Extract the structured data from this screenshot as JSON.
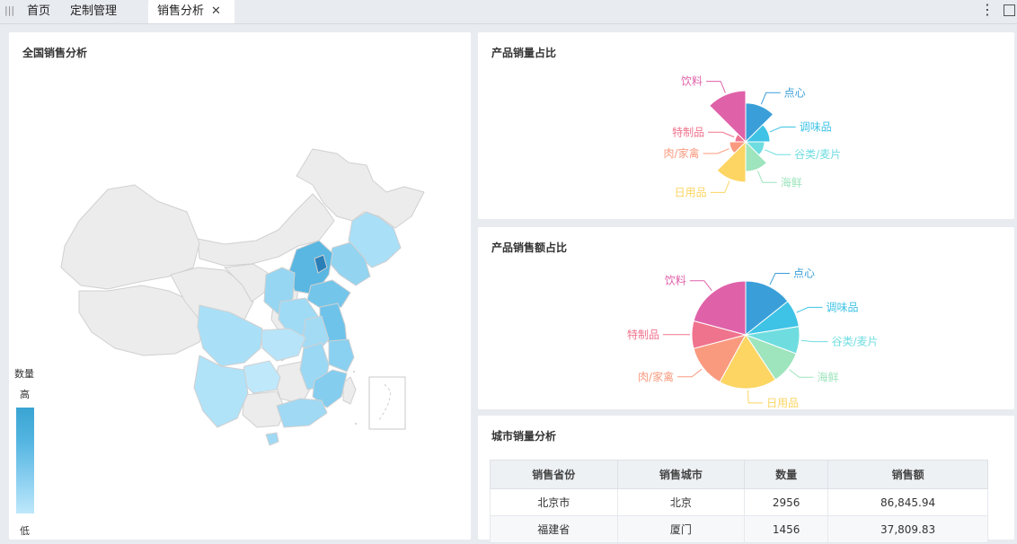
{
  "tabs": {
    "home": "首页",
    "custom": "定制管理",
    "sales": "销售分析",
    "close": "✕"
  },
  "map_panel": {
    "title": "全国销售分析",
    "legend_title": "数量",
    "legend_high": "高",
    "legend_low": "低",
    "colors": {
      "high": "#3aa4d3",
      "low": "#bee8fb",
      "nodata": "#ececec"
    }
  },
  "qty_panel": {
    "title": "产品销量占比"
  },
  "amt_panel": {
    "title": "产品销售额占比"
  },
  "city_panel": {
    "title": "城市销量分析",
    "columns": [
      "销售省份",
      "销售城市",
      "数量",
      "销售额"
    ],
    "rows": [
      [
        "北京市",
        "北京",
        "2956",
        "86,845.94"
      ],
      [
        "福建省",
        "厦门",
        "1456",
        "37,809.83"
      ]
    ]
  },
  "chart_data": [
    {
      "type": "pie",
      "variant": "rose",
      "title": "产品销量占比",
      "categories": [
        "点心",
        "调味品",
        "谷类/麦片",
        "海鲜",
        "日用品",
        "肉/家禽",
        "特制品",
        "饮料"
      ],
      "values": [
        0.72,
        0.45,
        0.35,
        0.55,
        0.75,
        0.3,
        0.2,
        0.95
      ],
      "colors": [
        "#3a9fd8",
        "#3ec3e6",
        "#6fdde0",
        "#9ee4bd",
        "#fcd562",
        "#f99a7f",
        "#f0738d",
        "#df62a9"
      ]
    },
    {
      "type": "pie",
      "title": "产品销售额占比",
      "categories": [
        "点心",
        "调味品",
        "谷类/麦片",
        "海鲜",
        "日用品",
        "肉/家禽",
        "特制品",
        "饮料"
      ],
      "values": [
        14.3,
        8.2,
        8.2,
        10.0,
        17.3,
        12.9,
        8.3,
        20.8
      ],
      "colors": [
        "#3a9fd8",
        "#3ec3e6",
        "#6fdde0",
        "#9ee4bd",
        "#fcd562",
        "#f99a7f",
        "#f0738d",
        "#df62a9"
      ]
    }
  ]
}
